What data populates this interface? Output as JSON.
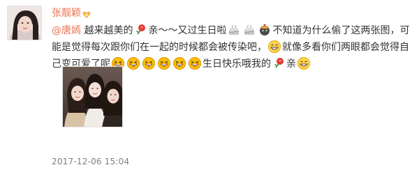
{
  "post": {
    "author": {
      "name": "张靓颖",
      "badge_icon": "vip-heart-icon"
    },
    "text": {
      "mention": "@唐嫣",
      "part1": " 越来越美的",
      "part2": "亲～～又过生日啦",
      "part3": "不知道为什么偷了这两张图，可能是觉得每次跟你们在一起的时候都会被传染吧，",
      "part4": "就像多看你们两眼都会觉得自己变可爱了呢",
      "part5": "生日快乐哦我的",
      "part6": "亲"
    },
    "emoticons": {
      "rose": "rose-icon",
      "cake": "birthday-cake-icon",
      "candle": "celebration-icon",
      "grin": "grinning-face-icon",
      "laugh": "laughing-face-icon"
    },
    "photo_alt": "three-friends-selfie",
    "timestamp": "2017-12-06 15:04"
  },
  "colors": {
    "link": "#eb7350",
    "text": "#333333",
    "meta": "#808080"
  }
}
